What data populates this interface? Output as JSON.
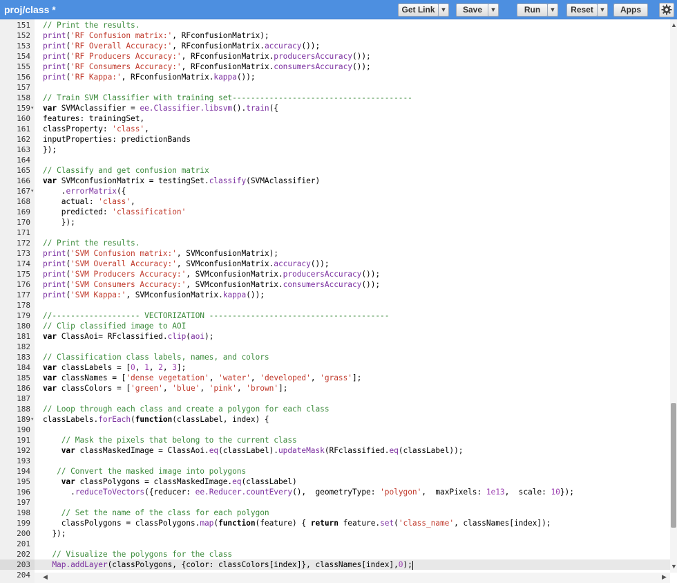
{
  "toolbar": {
    "title": "proj/class *",
    "get_link": "Get Link",
    "save": "Save",
    "run": "Run",
    "reset": "Reset",
    "apps": "Apps"
  },
  "icons": {
    "dropdown": "chevron-down-icon",
    "settings": "gear-icon",
    "fold": "fold-arrow-icon"
  },
  "colors": {
    "toolbar": "#4d8fe0",
    "comment": "#3a8a3a",
    "string": "#c0392b",
    "method": "#7b2fa0"
  },
  "editor": {
    "active_line": 203,
    "lines": [
      {
        "n": "151",
        "fold": "",
        "t": [
          [
            "c",
            "// Print the results."
          ]
        ]
      },
      {
        "n": "152",
        "fold": "",
        "t": [
          [
            "f",
            "print"
          ],
          [
            "p",
            "("
          ],
          [
            "s",
            "'RF Confusion matrix:'"
          ],
          [
            "p",
            ", RFconfusionMatrix);"
          ]
        ]
      },
      {
        "n": "153",
        "fold": "",
        "t": [
          [
            "f",
            "print"
          ],
          [
            "p",
            "("
          ],
          [
            "s",
            "'RF Overall Accuracy:'"
          ],
          [
            "p",
            ", RFconfusionMatrix."
          ],
          [
            "f",
            "accuracy"
          ],
          [
            "p",
            "());"
          ]
        ]
      },
      {
        "n": "154",
        "fold": "",
        "t": [
          [
            "f",
            "print"
          ],
          [
            "p",
            "("
          ],
          [
            "s",
            "'RF Producers Accuracy:'"
          ],
          [
            "p",
            ", RFconfusionMatrix."
          ],
          [
            "f",
            "producersAccuracy"
          ],
          [
            "p",
            "());"
          ]
        ]
      },
      {
        "n": "155",
        "fold": "",
        "t": [
          [
            "f",
            "print"
          ],
          [
            "p",
            "("
          ],
          [
            "s",
            "'RF Consumers Accuracy:'"
          ],
          [
            "p",
            ", RFconfusionMatrix."
          ],
          [
            "f",
            "consumersAccuracy"
          ],
          [
            "p",
            "());"
          ]
        ]
      },
      {
        "n": "156",
        "fold": "",
        "t": [
          [
            "f",
            "print"
          ],
          [
            "p",
            "("
          ],
          [
            "s",
            "'RF Kappa:'"
          ],
          [
            "p",
            ", RFconfusionMatrix."
          ],
          [
            "f",
            "kappa"
          ],
          [
            "p",
            "());"
          ]
        ]
      },
      {
        "n": "157",
        "fold": "",
        "t": []
      },
      {
        "n": "158",
        "fold": "",
        "t": [
          [
            "c",
            "// Train SVM Classifier with training set---------------------------------------"
          ]
        ]
      },
      {
        "n": "159",
        "fold": "▾",
        "t": [
          [
            "k",
            "var"
          ],
          [
            "p",
            " SVMAclassifier = "
          ],
          [
            "f",
            "ee.Classifier.libsvm"
          ],
          [
            "p",
            "()."
          ],
          [
            "f",
            "train"
          ],
          [
            "p",
            "({"
          ]
        ]
      },
      {
        "n": "160",
        "fold": "",
        "t": [
          [
            "p",
            "features: trainingSet,"
          ]
        ]
      },
      {
        "n": "161",
        "fold": "",
        "t": [
          [
            "p",
            "classProperty: "
          ],
          [
            "s",
            "'class'"
          ],
          [
            "p",
            ","
          ]
        ]
      },
      {
        "n": "162",
        "fold": "",
        "t": [
          [
            "p",
            "inputProperties: predictionBands"
          ]
        ]
      },
      {
        "n": "163",
        "fold": "",
        "t": [
          [
            "p",
            "});"
          ]
        ]
      },
      {
        "n": "164",
        "fold": "",
        "t": []
      },
      {
        "n": "165",
        "fold": "",
        "t": [
          [
            "c",
            "// Classify and get confusion matrix"
          ]
        ]
      },
      {
        "n": "166",
        "fold": "",
        "t": [
          [
            "k",
            "var"
          ],
          [
            "p",
            " SVMconfusionMatrix = testingSet."
          ],
          [
            "f",
            "classify"
          ],
          [
            "p",
            "(SVMAclassifier)"
          ]
        ]
      },
      {
        "n": "167",
        "fold": "▾",
        "t": [
          [
            "p",
            "    ."
          ],
          [
            "f",
            "errorMatrix"
          ],
          [
            "p",
            "({"
          ]
        ]
      },
      {
        "n": "168",
        "fold": "",
        "t": [
          [
            "p",
            "    actual: "
          ],
          [
            "s",
            "'class'"
          ],
          [
            "p",
            ","
          ]
        ]
      },
      {
        "n": "169",
        "fold": "",
        "t": [
          [
            "p",
            "    predicted: "
          ],
          [
            "s",
            "'classification'"
          ]
        ]
      },
      {
        "n": "170",
        "fold": "",
        "t": [
          [
            "p",
            "    });"
          ]
        ]
      },
      {
        "n": "171",
        "fold": "",
        "t": []
      },
      {
        "n": "172",
        "fold": "",
        "t": [
          [
            "c",
            "// Print the results."
          ]
        ]
      },
      {
        "n": "173",
        "fold": "",
        "t": [
          [
            "f",
            "print"
          ],
          [
            "p",
            "("
          ],
          [
            "s",
            "'SVM Confusion matrix:'"
          ],
          [
            "p",
            ", SVMconfusionMatrix);"
          ]
        ]
      },
      {
        "n": "174",
        "fold": "",
        "t": [
          [
            "f",
            "print"
          ],
          [
            "p",
            "("
          ],
          [
            "s",
            "'SVM Overall Accuracy:'"
          ],
          [
            "p",
            ", SVMconfusionMatrix."
          ],
          [
            "f",
            "accuracy"
          ],
          [
            "p",
            "());"
          ]
        ]
      },
      {
        "n": "175",
        "fold": "",
        "t": [
          [
            "f",
            "print"
          ],
          [
            "p",
            "("
          ],
          [
            "s",
            "'SVM Producers Accuracy:'"
          ],
          [
            "p",
            ", SVMconfusionMatrix."
          ],
          [
            "f",
            "producersAccuracy"
          ],
          [
            "p",
            "());"
          ]
        ]
      },
      {
        "n": "176",
        "fold": "",
        "t": [
          [
            "f",
            "print"
          ],
          [
            "p",
            "("
          ],
          [
            "s",
            "'SVM Consumers Accuracy:'"
          ],
          [
            "p",
            ", SVMconfusionMatrix."
          ],
          [
            "f",
            "consumersAccuracy"
          ],
          [
            "p",
            "());"
          ]
        ]
      },
      {
        "n": "177",
        "fold": "",
        "t": [
          [
            "f",
            "print"
          ],
          [
            "p",
            "("
          ],
          [
            "s",
            "'SVM Kappa:'"
          ],
          [
            "p",
            ", SVMconfusionMatrix."
          ],
          [
            "f",
            "kappa"
          ],
          [
            "p",
            "());"
          ]
        ]
      },
      {
        "n": "178",
        "fold": "",
        "t": []
      },
      {
        "n": "179",
        "fold": "",
        "t": [
          [
            "c",
            "//------------------- VECTORIZATION ---------------------------------------"
          ]
        ]
      },
      {
        "n": "180",
        "fold": "",
        "t": [
          [
            "c",
            "// Clip classified image to AOI"
          ]
        ]
      },
      {
        "n": "181",
        "fold": "",
        "t": [
          [
            "k",
            "var"
          ],
          [
            "p",
            " ClassAoi= RFclassified."
          ],
          [
            "f",
            "clip"
          ],
          [
            "p",
            "("
          ],
          [
            "f",
            "aoi"
          ],
          [
            "p",
            ");"
          ]
        ]
      },
      {
        "n": "182",
        "fold": "",
        "t": []
      },
      {
        "n": "183",
        "fold": "",
        "t": [
          [
            "c",
            "// Classification class labels, names, and colors"
          ]
        ]
      },
      {
        "n": "184",
        "fold": "",
        "t": [
          [
            "k",
            "var"
          ],
          [
            "p",
            " classLabels = ["
          ],
          [
            "n",
            "0"
          ],
          [
            "p",
            ", "
          ],
          [
            "n",
            "1"
          ],
          [
            "p",
            ", "
          ],
          [
            "n",
            "2"
          ],
          [
            "p",
            ", "
          ],
          [
            "n",
            "3"
          ],
          [
            "p",
            "];"
          ]
        ]
      },
      {
        "n": "185",
        "fold": "",
        "t": [
          [
            "k",
            "var"
          ],
          [
            "p",
            " classNames = ["
          ],
          [
            "s",
            "'dense vegetation'"
          ],
          [
            "p",
            ", "
          ],
          [
            "s",
            "'water'"
          ],
          [
            "p",
            ", "
          ],
          [
            "s",
            "'developed'"
          ],
          [
            "p",
            ", "
          ],
          [
            "s",
            "'grass'"
          ],
          [
            "p",
            "];"
          ]
        ]
      },
      {
        "n": "186",
        "fold": "",
        "t": [
          [
            "k",
            "var"
          ],
          [
            "p",
            " classColors = ["
          ],
          [
            "s",
            "'green'"
          ],
          [
            "p",
            ", "
          ],
          [
            "s",
            "'blue'"
          ],
          [
            "p",
            ", "
          ],
          [
            "s",
            "'pink'"
          ],
          [
            "p",
            ", "
          ],
          [
            "s",
            "'brown'"
          ],
          [
            "p",
            "];"
          ]
        ]
      },
      {
        "n": "187",
        "fold": "",
        "t": []
      },
      {
        "n": "188",
        "fold": "",
        "t": [
          [
            "c",
            "// Loop through each class and create a polygon for each class"
          ]
        ]
      },
      {
        "n": "189",
        "fold": "▾",
        "t": [
          [
            "p",
            "classLabels."
          ],
          [
            "f",
            "forEach"
          ],
          [
            "p",
            "("
          ],
          [
            "k",
            "function"
          ],
          [
            "p",
            "(classLabel, index) {"
          ]
        ]
      },
      {
        "n": "190",
        "fold": "",
        "t": []
      },
      {
        "n": "191",
        "fold": "",
        "t": [
          [
            "p",
            "    "
          ],
          [
            "c",
            "// Mask the pixels that belong to the current class"
          ]
        ]
      },
      {
        "n": "192",
        "fold": "",
        "t": [
          [
            "p",
            "    "
          ],
          [
            "k",
            "var"
          ],
          [
            "p",
            " classMaskedImage = ClassAoi."
          ],
          [
            "f",
            "eq"
          ],
          [
            "p",
            "(classLabel)."
          ],
          [
            "f",
            "updateMask"
          ],
          [
            "p",
            "(RFclassified."
          ],
          [
            "f",
            "eq"
          ],
          [
            "p",
            "(classLabel));"
          ]
        ]
      },
      {
        "n": "193",
        "fold": "",
        "t": []
      },
      {
        "n": "194",
        "fold": "",
        "t": [
          [
            "p",
            "   "
          ],
          [
            "c",
            "// Convert the masked image into polygons"
          ]
        ]
      },
      {
        "n": "195",
        "fold": "",
        "t": [
          [
            "p",
            "    "
          ],
          [
            "k",
            "var"
          ],
          [
            "p",
            " classPolygons = classMaskedImage."
          ],
          [
            "f",
            "eq"
          ],
          [
            "p",
            "(classLabel)"
          ]
        ]
      },
      {
        "n": "196",
        "fold": "",
        "t": [
          [
            "p",
            "      ."
          ],
          [
            "f",
            "reduceToVectors"
          ],
          [
            "p",
            "({reducer: "
          ],
          [
            "f",
            "ee.Reducer.countEvery"
          ],
          [
            "p",
            "(),  geometryType: "
          ],
          [
            "s",
            "'polygon'"
          ],
          [
            "p",
            ",  maxPixels: "
          ],
          [
            "n",
            "1e13"
          ],
          [
            "p",
            ",  scale: "
          ],
          [
            "n",
            "10"
          ],
          [
            "p",
            "});"
          ]
        ]
      },
      {
        "n": "197",
        "fold": "",
        "t": []
      },
      {
        "n": "198",
        "fold": "",
        "t": [
          [
            "p",
            "    "
          ],
          [
            "c",
            "// Set the name of the class for each polygon"
          ]
        ]
      },
      {
        "n": "199",
        "fold": "",
        "t": [
          [
            "p",
            "    classPolygons = classPolygons."
          ],
          [
            "f",
            "map"
          ],
          [
            "p",
            "("
          ],
          [
            "k",
            "function"
          ],
          [
            "p",
            "(feature) { "
          ],
          [
            "k",
            "return"
          ],
          [
            "p",
            " feature."
          ],
          [
            "f",
            "set"
          ],
          [
            "p",
            "("
          ],
          [
            "s",
            "'class_name'"
          ],
          [
            "p",
            ", classNames[index]);"
          ]
        ]
      },
      {
        "n": "200",
        "fold": "",
        "t": [
          [
            "p",
            "  });"
          ]
        ]
      },
      {
        "n": "201",
        "fold": "",
        "t": []
      },
      {
        "n": "202",
        "fold": "",
        "t": [
          [
            "p",
            "  "
          ],
          [
            "c",
            "// Visualize the polygons for the class"
          ]
        ]
      },
      {
        "n": "203",
        "fold": "",
        "t": [
          [
            "p",
            "  "
          ],
          [
            "f",
            "Map.addLayer"
          ],
          [
            "p",
            "(classPolygons, {color: classColors[index]}, classNames[index],"
          ],
          [
            "n",
            "0"
          ],
          [
            "p",
            ");"
          ]
        ]
      },
      {
        "n": "204",
        "fold": "",
        "t": []
      }
    ]
  }
}
